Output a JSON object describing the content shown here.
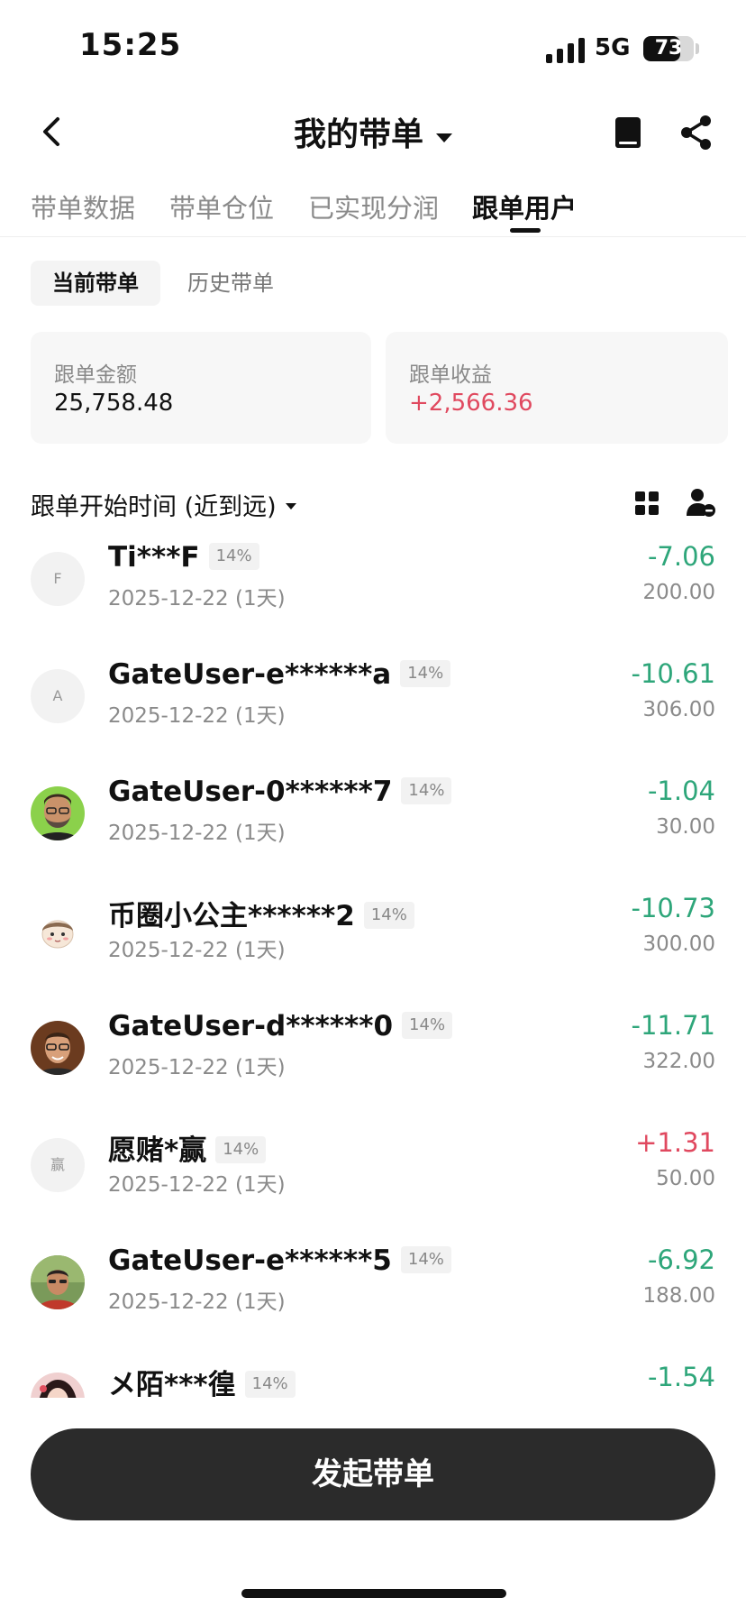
{
  "status_bar": {
    "time": "15:25",
    "network": "5G",
    "battery": "73",
    "battery_level": 0.73
  },
  "header": {
    "title": "我的带单",
    "icons": [
      "back-chevron-icon",
      "book-icon",
      "share-icon"
    ]
  },
  "tabs": [
    {
      "label": "带单数据",
      "active": false
    },
    {
      "label": "带单仓位",
      "active": false
    },
    {
      "label": "已实现分润",
      "active": false
    },
    {
      "label": "跟单用户",
      "active": true
    }
  ],
  "subtabs": {
    "current": "当前带单",
    "history": "历史带单"
  },
  "summary": {
    "amount_label": "跟单金额",
    "amount_value": "25,758.48",
    "profit_label": "跟单收益",
    "profit_value": "+2,566.36"
  },
  "sort": {
    "label": "跟单开始时间 (近到远)"
  },
  "users": [
    {
      "name": "Ti***F",
      "avatar": "F",
      "badge": "14%",
      "date": "2025-12-22 (1天)",
      "pnl": "-7.06",
      "amount": "200.00"
    },
    {
      "name": "GateUser-e******a",
      "avatar": "A",
      "badge": "14%",
      "date": "2025-12-22 (1天)",
      "pnl": "-10.61",
      "amount": "306.00"
    },
    {
      "name": "GateUser-0******7",
      "avatar": "",
      "badge": "14%",
      "date": "2025-12-22 (1天)",
      "pnl": "-1.04",
      "amount": "30.00"
    },
    {
      "name": "币圈小公主******2",
      "avatar": "",
      "badge": "14%",
      "date": "2025-12-22 (1天)",
      "pnl": "-10.73",
      "amount": "300.00"
    },
    {
      "name": "GateUser-d******0",
      "avatar": "",
      "badge": "14%",
      "date": "2025-12-22 (1天)",
      "pnl": "-11.71",
      "amount": "322.00"
    },
    {
      "name": "愿赌*赢",
      "avatar": "赢",
      "badge": "14%",
      "date": "2025-12-22 (1天)",
      "pnl": "+1.31",
      "amount": "50.00"
    },
    {
      "name": "GateUser-e******5",
      "avatar": "",
      "badge": "14%",
      "date": "2025-12-22 (1天)",
      "pnl": "-6.92",
      "amount": "188.00"
    },
    {
      "name": "メ陌***徨",
      "avatar": "",
      "badge": "14%",
      "date": "",
      "pnl": "-1.54",
      "amount": ""
    }
  ],
  "cta": {
    "label": "发起带单"
  },
  "colors": {
    "negative": "#2ea67a",
    "positive": "#e0495f",
    "cta_bg": "#2b2b2b"
  }
}
